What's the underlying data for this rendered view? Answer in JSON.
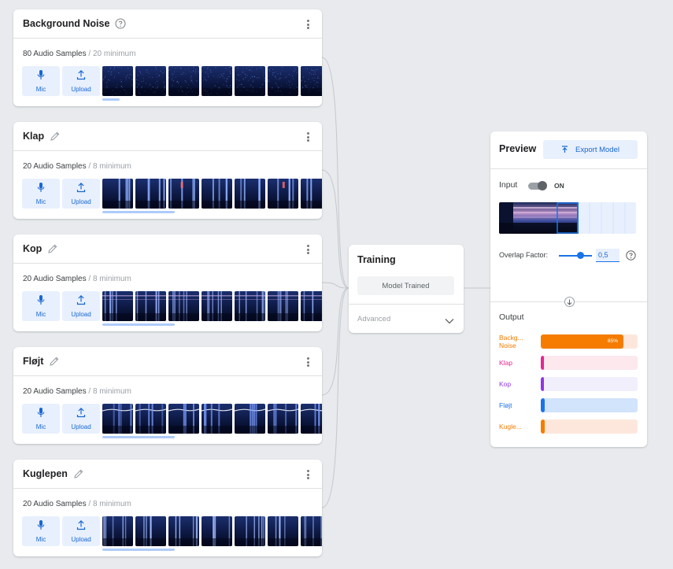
{
  "classes": [
    {
      "title": "Background Noise",
      "title_icon": "help-icon",
      "count": "80 Audio Samples",
      "minimum": "/ 20 minimum",
      "style": "noise",
      "scroll_fraction": 0.08
    },
    {
      "title": "Klap",
      "title_icon": "edit-icon",
      "count": "20 Audio Samples",
      "minimum": "/ 8 minimum",
      "style": "klap",
      "scroll_fraction": 0.33
    },
    {
      "title": "Kop",
      "title_icon": "edit-icon",
      "count": "20 Audio Samples",
      "minimum": "/ 8 minimum",
      "style": "kop",
      "scroll_fraction": 0.33
    },
    {
      "title": "Fløjt",
      "title_icon": "edit-icon",
      "count": "20 Audio Samples",
      "minimum": "/ 8 minimum",
      "style": "flojt",
      "scroll_fraction": 0.33
    },
    {
      "title": "Kuglepen",
      "title_icon": "edit-icon",
      "count": "20 Audio Samples",
      "minimum": "/ 8 minimum",
      "style": "kuglepen",
      "scroll_fraction": 0.33
    }
  ],
  "sample_buttons": {
    "mic": "Mic",
    "mic_icon": "mic-icon",
    "upload": "Upload",
    "upload_icon": "upload-icon"
  },
  "training": {
    "title": "Training",
    "button": "Model Trained",
    "advanced": "Advanced"
  },
  "preview": {
    "title": "Preview",
    "export": "Export Model",
    "input_label": "Input",
    "input_state": "ON",
    "overlap_label": "Overlap Factor:",
    "overlap_value": "0,5",
    "overlap_fraction": 0.64,
    "output_label": "Output",
    "outputs": [
      {
        "name": "Backg... Noise",
        "fraction": 0.85,
        "percent": "85%",
        "color": "#f57c00",
        "track": "#fde7dc"
      },
      {
        "name": "Klap",
        "fraction": 0.02,
        "percent": "",
        "color": "#e52592",
        "track": "#fde8ee"
      },
      {
        "name": "Kop",
        "fraction": 0.02,
        "percent": "",
        "color": "#9334e6",
        "track": "#f1effb"
      },
      {
        "name": "Fløjt",
        "fraction": 0.04,
        "percent": "",
        "color": "#1a73e8",
        "track": "#d2e3fc"
      },
      {
        "name": "Kugle...",
        "fraction": 0.04,
        "percent": "",
        "color": "#f57c00",
        "track": "#fde7dc"
      }
    ]
  },
  "colors": {
    "accent": "#1a73e8",
    "accent_bg": "#e8f0fe",
    "page_bg": "#e8eaed"
  }
}
